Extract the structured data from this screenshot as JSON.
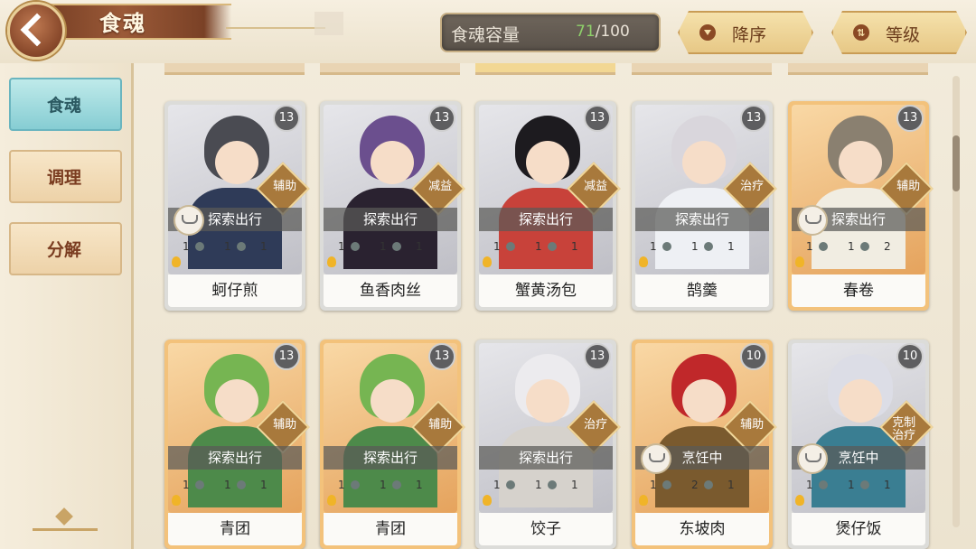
{
  "header": {
    "title": "食魂",
    "capacity": {
      "label": "食魂容量",
      "current": "71",
      "max": "/100"
    },
    "sort_order_label": "降序",
    "sort_key_label": "等级"
  },
  "sidebar": {
    "tabs": [
      {
        "label": "食魂",
        "active": true
      },
      {
        "label": "调理",
        "active": false
      },
      {
        "label": "分解",
        "active": false
      }
    ]
  },
  "cards": [
    {
      "name": "蚵仔煎",
      "level": "13",
      "role": "辅助",
      "status": "探索出行",
      "status_icon": true,
      "stats": [
        "1",
        "1",
        "1"
      ],
      "frame": "silver",
      "hair": "#4a4b52",
      "outfit": "#2f3b58"
    },
    {
      "name": "鱼香肉丝",
      "level": "13",
      "role": "减益",
      "status": "探索出行",
      "status_icon": false,
      "stats": [
        "1",
        "1",
        "1"
      ],
      "frame": "silver",
      "hair": "#6b4f8e",
      "outfit": "#2a2230"
    },
    {
      "name": "蟹黄汤包",
      "level": "13",
      "role": "减益",
      "status": "探索出行",
      "status_icon": false,
      "stats": [
        "1",
        "1",
        "1"
      ],
      "frame": "silver",
      "hair": "#1d1b1f",
      "outfit": "#c8423a"
    },
    {
      "name": "鹄羹",
      "level": "13",
      "role": "治疗",
      "status": "探索出行",
      "status_icon": false,
      "stats": [
        "1",
        "1",
        "1"
      ],
      "frame": "silver",
      "hair": "#d9d6dc",
      "outfit": "#eef0f4"
    },
    {
      "name": "春卷",
      "level": "13",
      "role": "辅助",
      "status": "探索出行",
      "status_icon": true,
      "stats": [
        "1",
        "1",
        "2"
      ],
      "frame": "gold",
      "hair": "#8a8070",
      "outfit": "#f1ede2"
    },
    {
      "name": "青团",
      "level": "13",
      "role": "辅助",
      "status": "探索出行",
      "status_icon": false,
      "stats": [
        "1",
        "1",
        "1"
      ],
      "frame": "gold",
      "hair": "#76b552",
      "outfit": "#4d8a4a"
    },
    {
      "name": "青团",
      "level": "13",
      "role": "辅助",
      "status": "探索出行",
      "status_icon": false,
      "stats": [
        "1",
        "1",
        "1"
      ],
      "frame": "gold",
      "hair": "#76b552",
      "outfit": "#4d8a4a"
    },
    {
      "name": "饺子",
      "level": "13",
      "role": "治疗",
      "status": "探索出行",
      "status_icon": false,
      "stats": [
        "1",
        "1",
        "1"
      ],
      "frame": "silver",
      "hair": "#ecebee",
      "outfit": "#d6d2cc"
    },
    {
      "name": "东坡肉",
      "level": "10",
      "role": "辅助",
      "status": "烹饪中",
      "status_icon": true,
      "stats": [
        "1",
        "2",
        "1"
      ],
      "frame": "gold",
      "hair": "#c0282a",
      "outfit": "#7a5a2e"
    },
    {
      "name": "煲仔饭",
      "level": "10",
      "role": "克制\n治疗",
      "status": "烹饪中",
      "status_icon": true,
      "stats": [
        "1",
        "1",
        "1"
      ],
      "frame": "silver",
      "hair": "#dcdde6",
      "outfit": "#3a7e92"
    }
  ]
}
